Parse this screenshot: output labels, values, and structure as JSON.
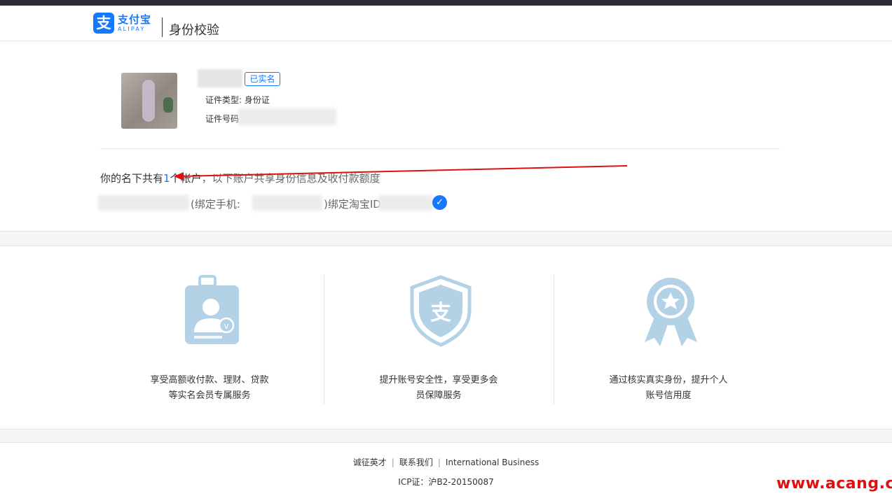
{
  "header": {
    "logo_cn": "支付宝",
    "logo_en": "ALIPAY",
    "logo_mark": "支",
    "page_title": "身份校验"
  },
  "profile": {
    "verified_badge": "已实名",
    "id_type": "证件类型: 身份证",
    "id_number_label": "证件号码"
  },
  "accounts": {
    "prefix": "你的名下共有",
    "count": "1",
    "unit": "个帐户",
    "note": "，以下账户共享身份信息及收付款额度",
    "phone_label": "(绑定手机:",
    "taobao_label": ")绑定淘宝ID"
  },
  "benefits": [
    {
      "icon": "id-card-icon",
      "line1": "享受高额收付款、理财、贷款",
      "line2": "等实名会员专属服务"
    },
    {
      "icon": "shield-icon",
      "line1": "提升账号安全性，享受更多会",
      "line2": "员保障服务"
    },
    {
      "icon": "award-ribbon-icon",
      "line1": "通过核实真实身份，提升个人",
      "line2": "账号信用度"
    }
  ],
  "footer": {
    "links": [
      "诚征英才",
      "联系我们",
      "International Business"
    ],
    "icp": "ICP证：沪B2-20150087"
  },
  "watermark": "www.acang.cn",
  "colors": {
    "brand_blue": "#1677ff",
    "icon_blue": "#b3d2e6",
    "annotation_red": "#e01010"
  }
}
